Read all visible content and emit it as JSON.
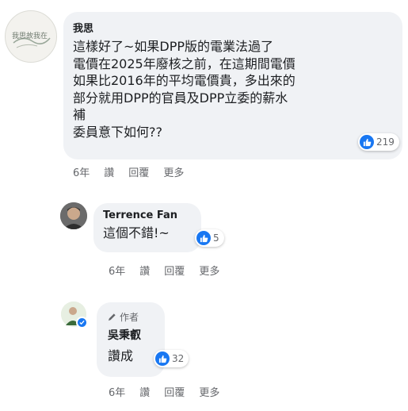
{
  "comments": [
    {
      "author": "我思",
      "avatar_text": "我思故我在",
      "text": "這樣好了~如果DPP版的電業法過了\n電價在2025年廢核之前，在這期間電價\n如果比2016年的平均電價貴，多出來的\n部分就用DPP的官員及DPP立委的薪水\n補\n委員意下如何??",
      "likes": "219",
      "actions": [
        "6年",
        "讚",
        "回覆",
        "更多"
      ]
    },
    {
      "author": "Terrence Fan",
      "text": "這個不錯!~",
      "likes": "5",
      "actions": [
        "6年",
        "讚",
        "回覆",
        "更多"
      ]
    },
    {
      "author_tag": "作者",
      "author": "吳秉叡",
      "text": "讚成",
      "likes": "32",
      "actions": [
        "6年",
        "讚",
        "回覆",
        "更多"
      ]
    }
  ],
  "colors": {
    "bubble": "#f0f2f5",
    "like_blue": "#1877f2",
    "meta_text": "#65676b"
  }
}
